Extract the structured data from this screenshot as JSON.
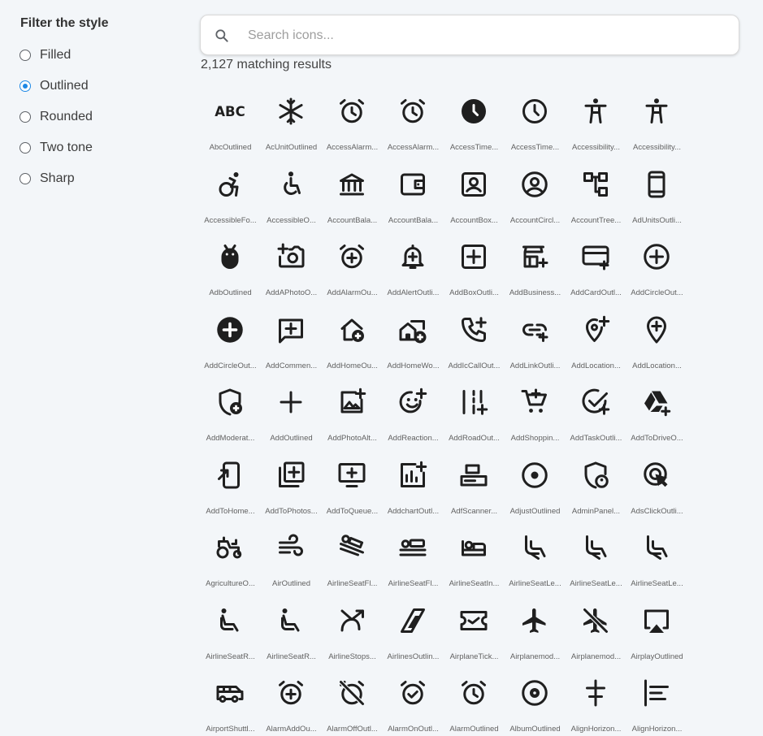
{
  "sidebar": {
    "title": "Filter the style",
    "options": [
      {
        "label": "Filled",
        "checked": false
      },
      {
        "label": "Outlined",
        "checked": true
      },
      {
        "label": "Rounded",
        "checked": false
      },
      {
        "label": "Two tone",
        "checked": false
      },
      {
        "label": "Sharp",
        "checked": false
      }
    ]
  },
  "search": {
    "placeholder": "Search icons...",
    "value": "",
    "icon": "search-icon"
  },
  "results": {
    "count_text": "2,127 matching results"
  },
  "colors": {
    "accent": "#1e88e5",
    "background": "#f3f6f9",
    "icon": "#1f1f1f"
  },
  "icons": [
    {
      "label": "AbcOutlined",
      "icon": "abc"
    },
    {
      "label": "AcUnitOutlined",
      "icon": "ac-unit"
    },
    {
      "label": "AccessAlarm...",
      "icon": "alarm"
    },
    {
      "label": "AccessAlarm...",
      "icon": "alarm"
    },
    {
      "label": "AccessTime...",
      "icon": "clock-filled"
    },
    {
      "label": "AccessTime...",
      "icon": "clock"
    },
    {
      "label": "Accessibility...",
      "icon": "accessibility"
    },
    {
      "label": "Accessibility...",
      "icon": "accessibility"
    },
    {
      "label": "AccessibleFo...",
      "icon": "accessible-forward"
    },
    {
      "label": "AccessibleO...",
      "icon": "accessible"
    },
    {
      "label": "AccountBala...",
      "icon": "bank"
    },
    {
      "label": "AccountBala...",
      "icon": "wallet"
    },
    {
      "label": "AccountBox...",
      "icon": "account-box"
    },
    {
      "label": "AccountCircl...",
      "icon": "account-circle"
    },
    {
      "label": "AccountTree...",
      "icon": "account-tree"
    },
    {
      "label": "AdUnitsOutli...",
      "icon": "phone"
    },
    {
      "label": "AdbOutlined",
      "icon": "adb"
    },
    {
      "label": "AddAPhotoO...",
      "icon": "add-photo"
    },
    {
      "label": "AddAlarmOu...",
      "icon": "add-alarm"
    },
    {
      "label": "AddAlertOutli...",
      "icon": "add-alert"
    },
    {
      "label": "AddBoxOutli...",
      "icon": "add-box"
    },
    {
      "label": "AddBusiness...",
      "icon": "add-business"
    },
    {
      "label": "AddCardOutl...",
      "icon": "add-card"
    },
    {
      "label": "AddCircleOut...",
      "icon": "add-circle"
    },
    {
      "label": "AddCircleOut...",
      "icon": "add-circle-filled"
    },
    {
      "label": "AddCommen...",
      "icon": "add-comment"
    },
    {
      "label": "AddHomeOu...",
      "icon": "add-home"
    },
    {
      "label": "AddHomeWo...",
      "icon": "add-home-work"
    },
    {
      "label": "AddIcCallOut...",
      "icon": "add-call"
    },
    {
      "label": "AddLinkOutli...",
      "icon": "add-link"
    },
    {
      "label": "AddLocation...",
      "icon": "add-location-alt"
    },
    {
      "label": "AddLocation...",
      "icon": "add-location"
    },
    {
      "label": "AddModerat...",
      "icon": "add-moderator"
    },
    {
      "label": "AddOutlined",
      "icon": "add"
    },
    {
      "label": "AddPhotoAlt...",
      "icon": "add-photo-alt"
    },
    {
      "label": "AddReaction...",
      "icon": "add-reaction"
    },
    {
      "label": "AddRoadOut...",
      "icon": "add-road"
    },
    {
      "label": "AddShoppin...",
      "icon": "add-cart"
    },
    {
      "label": "AddTaskOutli...",
      "icon": "add-task"
    },
    {
      "label": "AddToDriveO...",
      "icon": "add-to-drive"
    },
    {
      "label": "AddToHome...",
      "icon": "add-to-home"
    },
    {
      "label": "AddToPhotos...",
      "icon": "add-to-photos"
    },
    {
      "label": "AddToQueue...",
      "icon": "add-to-queue"
    },
    {
      "label": "AddchartOutl...",
      "icon": "add-chart"
    },
    {
      "label": "AdfScanner...",
      "icon": "scanner"
    },
    {
      "label": "AdjustOutlined",
      "icon": "adjust"
    },
    {
      "label": "AdminPanel...",
      "icon": "admin-panel"
    },
    {
      "label": "AdsClickOutli...",
      "icon": "ads-click"
    },
    {
      "label": "AgricultureO...",
      "icon": "tractor"
    },
    {
      "label": "AirOutlined",
      "icon": "air"
    },
    {
      "label": "AirlineSeatFl...",
      "icon": "seat-flat-angled"
    },
    {
      "label": "AirlineSeatFl...",
      "icon": "seat-flat"
    },
    {
      "label": "AirlineSeatIn...",
      "icon": "seat-individual"
    },
    {
      "label": "AirlineSeatLe...",
      "icon": "seat-legroom"
    },
    {
      "label": "AirlineSeatLe...",
      "icon": "seat-legroom"
    },
    {
      "label": "AirlineSeatLe...",
      "icon": "seat-legroom"
    },
    {
      "label": "AirlineSeatR...",
      "icon": "seat-recline"
    },
    {
      "label": "AirlineSeatR...",
      "icon": "seat-recline"
    },
    {
      "label": "AirlineStops...",
      "icon": "airline-stops"
    },
    {
      "label": "AirlinesOutlin...",
      "icon": "airlines"
    },
    {
      "label": "AirplaneTick...",
      "icon": "ticket"
    },
    {
      "label": "Airplanemod...",
      "icon": "airplane"
    },
    {
      "label": "Airplanemod...",
      "icon": "airplane-off"
    },
    {
      "label": "AirplayOutlined",
      "icon": "airplay"
    },
    {
      "label": "AirportShuttl...",
      "icon": "shuttle"
    },
    {
      "label": "AlarmAddOu...",
      "icon": "add-alarm"
    },
    {
      "label": "AlarmOffOutl...",
      "icon": "alarm-off"
    },
    {
      "label": "AlarmOnOutl...",
      "icon": "alarm-on"
    },
    {
      "label": "AlarmOutlined",
      "icon": "alarm"
    },
    {
      "label": "AlbumOutlined",
      "icon": "album"
    },
    {
      "label": "AlignHorizon...",
      "icon": "align-center"
    },
    {
      "label": "AlignHorizon...",
      "icon": "align-left"
    }
  ]
}
